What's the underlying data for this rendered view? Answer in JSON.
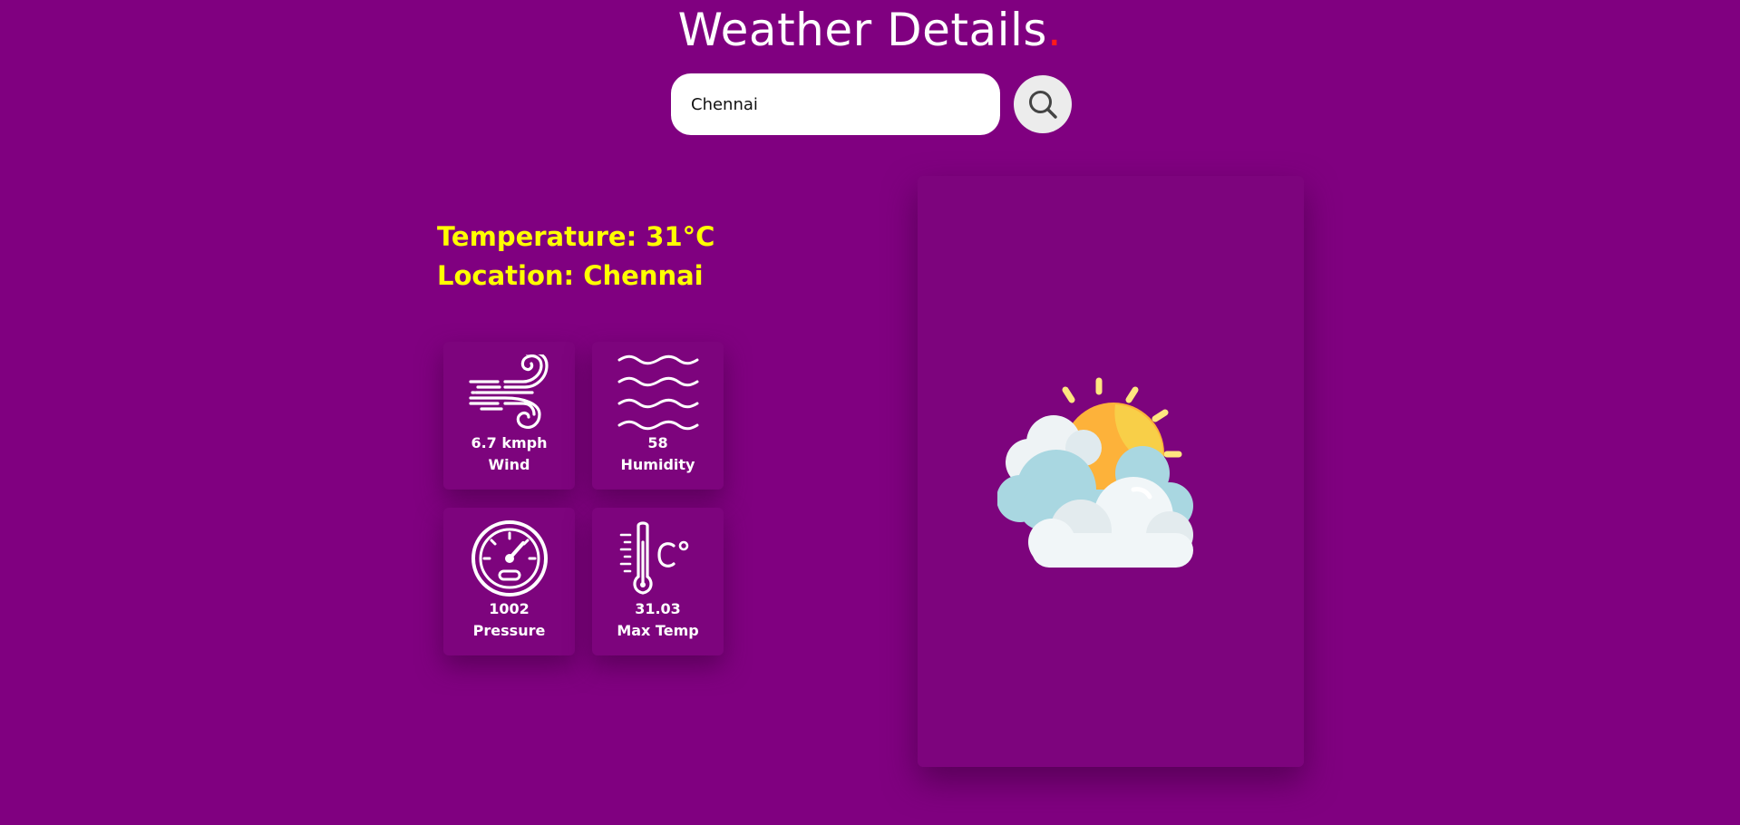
{
  "header": {
    "title": "Weather Details",
    "title_dot": "."
  },
  "search": {
    "value": "Chennai",
    "placeholder": "Chennai",
    "button_icon": "search-icon"
  },
  "summary": {
    "temperature": "Temperature: 31°C",
    "location": "Location: Chennai"
  },
  "stats": {
    "wind": {
      "value": "6.7 kmph",
      "label": "Wind",
      "icon": "wind-icon"
    },
    "humidity": {
      "value": "58",
      "label": "Humidity",
      "icon": "waves-icon"
    },
    "pressure": {
      "value": "1002",
      "label": "Pressure",
      "icon": "gauge-icon"
    },
    "max_temp": {
      "value": "31.03",
      "label": "Max Temp",
      "icon": "thermometer-icon"
    }
  },
  "weather_icon": "partly-cloudy-icon",
  "colors": {
    "background": "#800080",
    "accent_text": "#ffff00",
    "title_dot": "#ff1a1a",
    "card": "#7d047d"
  }
}
